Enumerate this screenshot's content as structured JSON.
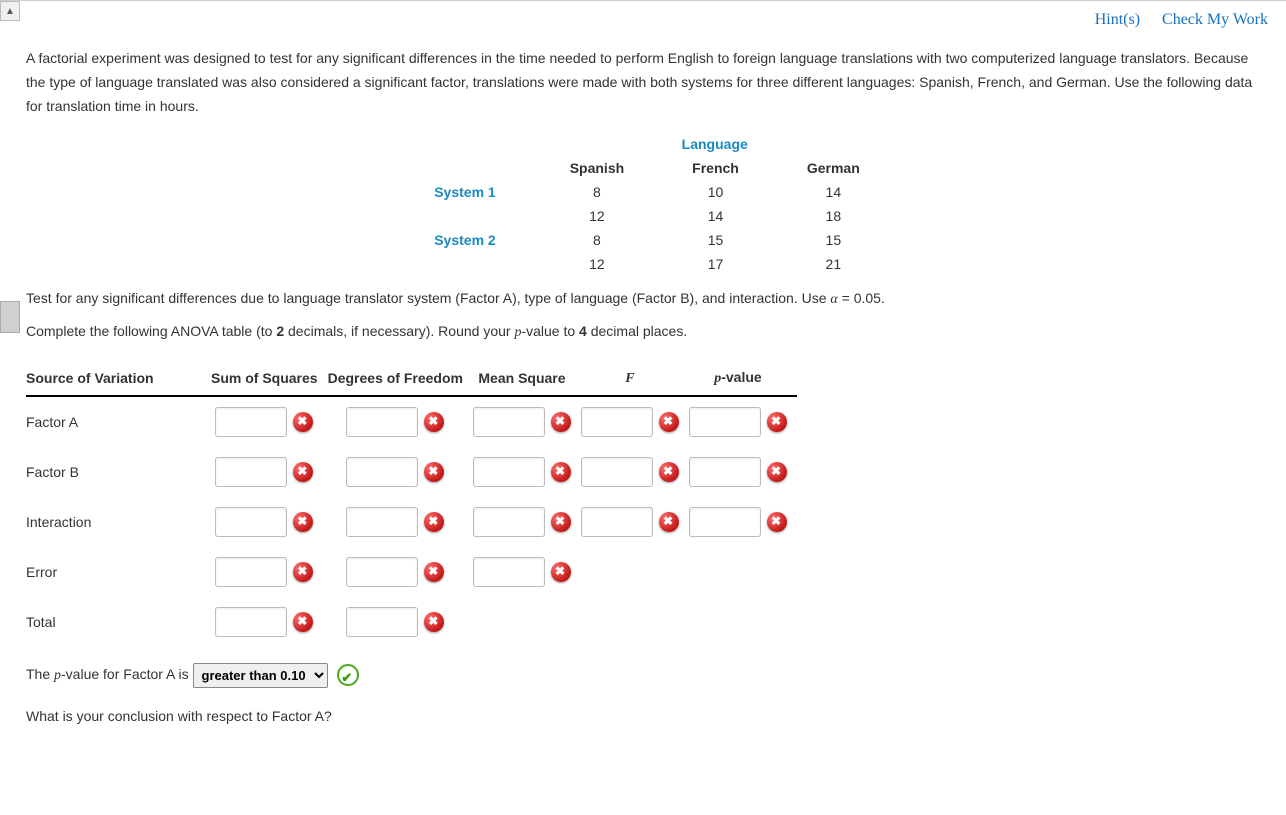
{
  "topLinks": {
    "hints": "Hint(s)",
    "check": "Check My Work"
  },
  "intro": "A factorial experiment was designed to test for any significant differences in the time needed to perform English to foreign language translations with two computerized language translators. Because the type of language translated was also considered a significant factor, translations were made with both systems for three different languages: Spanish, French, and German. Use the following data for translation time in hours.",
  "dataTable": {
    "superHeader": "Language",
    "cols": [
      "Spanish",
      "French",
      "German"
    ],
    "rows": [
      {
        "label": "System 1",
        "vals": [
          "8",
          "10",
          "14"
        ]
      },
      {
        "label": "",
        "vals": [
          "12",
          "14",
          "18"
        ]
      },
      {
        "label": "System 2",
        "vals": [
          "8",
          "15",
          "15"
        ]
      },
      {
        "label": "",
        "vals": [
          "12",
          "17",
          "21"
        ]
      }
    ]
  },
  "afterTable": {
    "line1a": "Test for any significant differences due to language translator system (Factor A), type of language (Factor B), and interaction. Use ",
    "alphaSym": "α",
    "alphaEq": " = 0.05",
    "line1b": ".",
    "line2a": "Complete the following ANOVA table (to ",
    "two": "2",
    "line2b": " decimals, if necessary). Round your ",
    "pval": "p",
    "line2c": "-value to ",
    "four": "4",
    "line2d": " decimal places."
  },
  "anova": {
    "headers": [
      "Source of Variation",
      "Sum of Squares",
      "Degrees of Freedom",
      "Mean Square",
      "F",
      "p-value"
    ],
    "fHeaderItalic": "F",
    "pHeader": "p-value",
    "rows": [
      {
        "label": "Factor A",
        "cells": 5
      },
      {
        "label": "Factor B",
        "cells": 5
      },
      {
        "label": "Interaction",
        "cells": 5
      },
      {
        "label": "Error",
        "cells": 3
      },
      {
        "label": "Total",
        "cells": 2
      }
    ]
  },
  "q1": {
    "pre": "The ",
    "p": "p",
    "mid": "-value for Factor A is",
    "selected": "greater than 0.10"
  },
  "q2": "What is your conclusion with respect to Factor A?"
}
